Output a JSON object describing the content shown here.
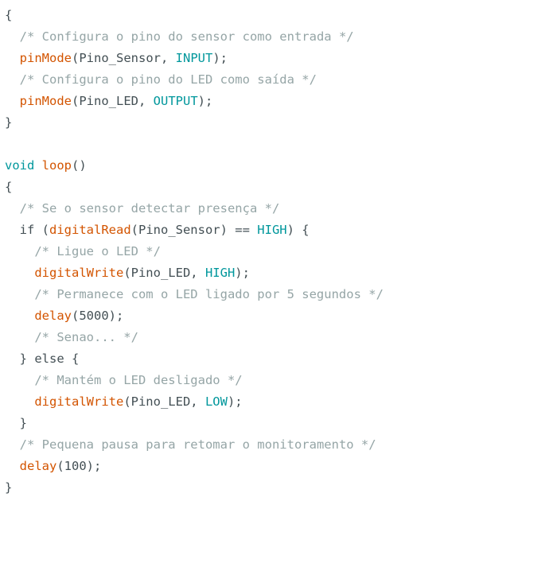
{
  "colors": {
    "text": "#434f54",
    "comment": "#95a5a6",
    "function": "#d35400",
    "keyword_type": "#00979c",
    "constant": "#00979c",
    "punctuation_brace": "#434f54"
  },
  "code_lines": [
    [
      {
        "t": "{",
        "c": "brace"
      }
    ],
    [
      {
        "t": "  ",
        "c": "text"
      },
      {
        "t": "/* Configura o pino do sensor como entrada */",
        "c": "comment"
      }
    ],
    [
      {
        "t": "  ",
        "c": "text"
      },
      {
        "t": "pinMode",
        "c": "function"
      },
      {
        "t": "(Pino_Sensor, ",
        "c": "text"
      },
      {
        "t": "INPUT",
        "c": "constant"
      },
      {
        "t": ");",
        "c": "text"
      }
    ],
    [
      {
        "t": "  ",
        "c": "text"
      },
      {
        "t": "/* Configura o pino do LED como saída */",
        "c": "comment"
      }
    ],
    [
      {
        "t": "  ",
        "c": "text"
      },
      {
        "t": "pinMode",
        "c": "function"
      },
      {
        "t": "(Pino_LED, ",
        "c": "text"
      },
      {
        "t": "OUTPUT",
        "c": "constant"
      },
      {
        "t": ");",
        "c": "text"
      }
    ],
    [
      {
        "t": "}",
        "c": "brace"
      }
    ],
    [],
    [
      {
        "t": "void",
        "c": "keyword_type"
      },
      {
        "t": " ",
        "c": "text"
      },
      {
        "t": "loop",
        "c": "function"
      },
      {
        "t": "()",
        "c": "text"
      }
    ],
    [
      {
        "t": "{",
        "c": "brace"
      }
    ],
    [
      {
        "t": "  ",
        "c": "text"
      },
      {
        "t": "/* Se o sensor detectar presença */",
        "c": "comment"
      }
    ],
    [
      {
        "t": "  if (",
        "c": "text"
      },
      {
        "t": "digitalRead",
        "c": "function"
      },
      {
        "t": "(Pino_Sensor) == ",
        "c": "text"
      },
      {
        "t": "HIGH",
        "c": "constant"
      },
      {
        "t": ") {",
        "c": "text"
      }
    ],
    [
      {
        "t": "    ",
        "c": "text"
      },
      {
        "t": "/* Ligue o LED */",
        "c": "comment"
      }
    ],
    [
      {
        "t": "    ",
        "c": "text"
      },
      {
        "t": "digitalWrite",
        "c": "function"
      },
      {
        "t": "(Pino_LED, ",
        "c": "text"
      },
      {
        "t": "HIGH",
        "c": "constant"
      },
      {
        "t": ");",
        "c": "text"
      }
    ],
    [
      {
        "t": "    ",
        "c": "text"
      },
      {
        "t": "/* Permanece com o LED ligado por 5 segundos */",
        "c": "comment"
      }
    ],
    [
      {
        "t": "    ",
        "c": "text"
      },
      {
        "t": "delay",
        "c": "function"
      },
      {
        "t": "(5000);",
        "c": "text"
      }
    ],
    [
      {
        "t": "    ",
        "c": "text"
      },
      {
        "t": "/* Senao... */",
        "c": "comment"
      }
    ],
    [
      {
        "t": "  } else {",
        "c": "text"
      }
    ],
    [
      {
        "t": "    ",
        "c": "text"
      },
      {
        "t": "/* Mantém o LED desligado */",
        "c": "comment"
      }
    ],
    [
      {
        "t": "    ",
        "c": "text"
      },
      {
        "t": "digitalWrite",
        "c": "function"
      },
      {
        "t": "(Pino_LED, ",
        "c": "text"
      },
      {
        "t": "LOW",
        "c": "constant"
      },
      {
        "t": ");",
        "c": "text"
      }
    ],
    [
      {
        "t": "  ",
        "c": "text"
      },
      {
        "t": "}",
        "c": "brace"
      }
    ],
    [
      {
        "t": "  ",
        "c": "text"
      },
      {
        "t": "/* Pequena pausa para retomar o monitoramento */",
        "c": "comment"
      }
    ],
    [
      {
        "t": "  ",
        "c": "text"
      },
      {
        "t": "delay",
        "c": "function"
      },
      {
        "t": "(100);",
        "c": "text"
      }
    ],
    [
      {
        "t": "}",
        "c": "brace"
      }
    ]
  ]
}
